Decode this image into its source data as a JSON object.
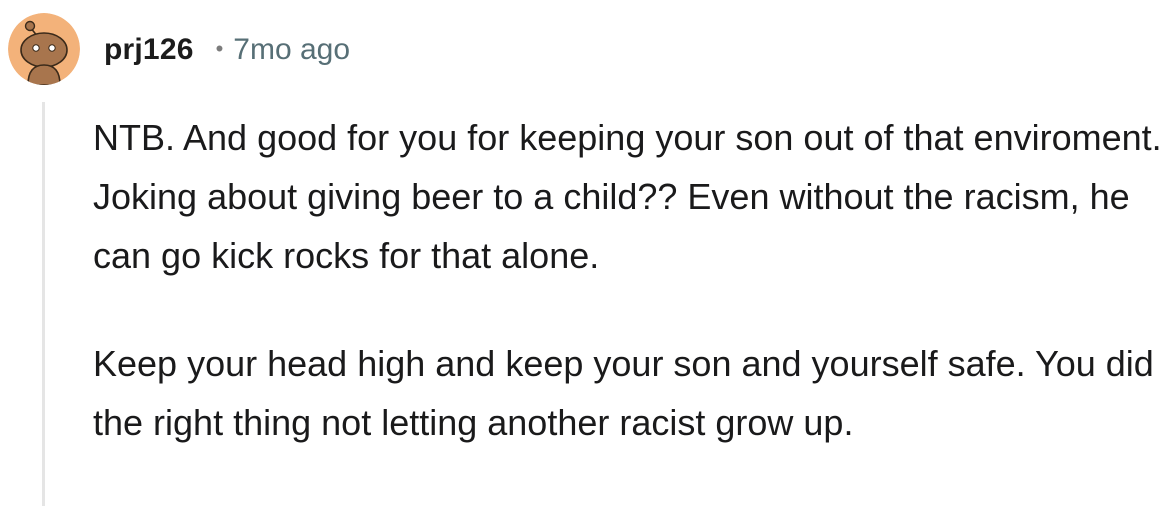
{
  "comment": {
    "author": "prj126",
    "separator": "•",
    "timestamp": "7mo ago",
    "avatar_icon": "reddit-snoo-avatar-icon",
    "avatar_color": "#f3b27a",
    "paragraphs": [
      "NTB. And good for you for keeping your son out of that enviroment. Joking about giving beer to a child?? Even without the racism, he can go kick rocks for that alone.",
      "Keep your head high and keep your son and yourself safe. You did the right thing not letting another racist grow up."
    ]
  }
}
